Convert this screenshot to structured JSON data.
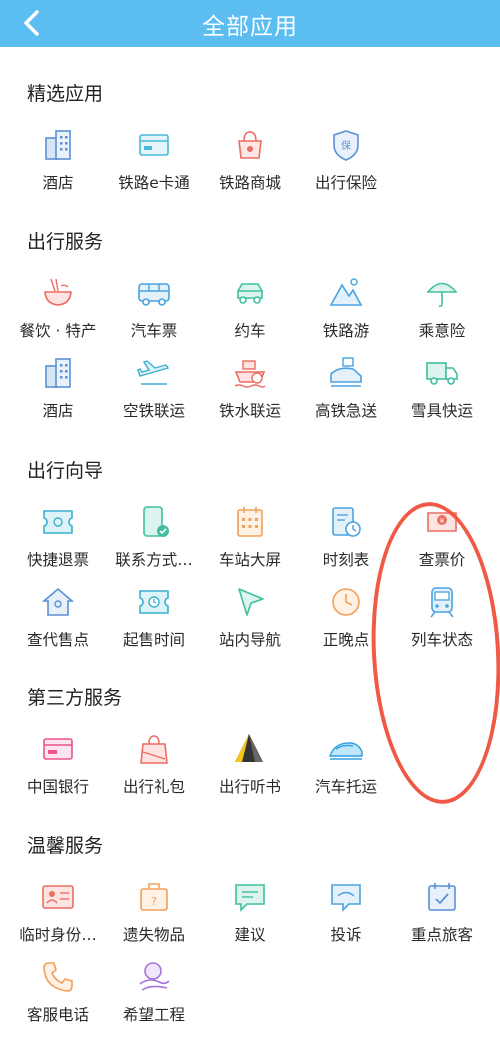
{
  "header": {
    "title": "全部应用",
    "back_icon": "chevron-left-icon",
    "bg_color": "#5bbdf0"
  },
  "sections": {
    "featured": {
      "title": "精选应用",
      "items": [
        {
          "label": "酒店",
          "icon": "hotel-icon"
        },
        {
          "label": "铁路e卡通",
          "icon": "card-icon"
        },
        {
          "label": "铁路商城",
          "icon": "shopping-bag-icon"
        },
        {
          "label": "出行保险",
          "icon": "insurance-shield-icon"
        }
      ]
    },
    "travel": {
      "title": "出行服务",
      "items": [
        {
          "label": "餐饮 · 特产",
          "icon": "noodle-bowl-icon"
        },
        {
          "label": "汽车票",
          "icon": "bus-icon"
        },
        {
          "label": "约车",
          "icon": "car-icon"
        },
        {
          "label": "铁路游",
          "icon": "mountain-icon"
        },
        {
          "label": "乘意险",
          "icon": "umbrella-icon"
        },
        {
          "label": "酒店",
          "icon": "hotel-icon"
        },
        {
          "label": "空铁联运",
          "icon": "plane-icon"
        },
        {
          "label": "铁水联运",
          "icon": "ship-icon"
        },
        {
          "label": "高铁急送",
          "icon": "express-train-icon"
        },
        {
          "label": "雪具快运",
          "icon": "truck-icon"
        }
      ]
    },
    "guide": {
      "title": "出行向导",
      "items": [
        {
          "label": "快捷退票",
          "icon": "refund-ticket-icon"
        },
        {
          "label": "联系方式…",
          "icon": "phone-contact-icon"
        },
        {
          "label": "车站大屏",
          "icon": "station-screen-icon"
        },
        {
          "label": "时刻表",
          "icon": "timetable-icon"
        },
        {
          "label": "查票价",
          "icon": "fare-ticket-icon"
        },
        {
          "label": "查代售点",
          "icon": "agency-house-icon"
        },
        {
          "label": "起售时间",
          "icon": "clock-ticket-icon"
        },
        {
          "label": "站内导航",
          "icon": "navigation-arrow-icon"
        },
        {
          "label": "正晚点",
          "icon": "clock-icon"
        },
        {
          "label": "列车状态",
          "icon": "train-icon"
        }
      ]
    },
    "third_party": {
      "title": "第三方服务",
      "items": [
        {
          "label": "中国银行",
          "icon": "bank-card-icon"
        },
        {
          "label": "出行礼包",
          "icon": "gift-bag-icon"
        },
        {
          "label": "出行听书",
          "icon": "audiobook-icon"
        },
        {
          "label": "汽车托运",
          "icon": "car-shipping-icon"
        }
      ]
    },
    "care": {
      "title": "温馨服务",
      "items": [
        {
          "label": "临时身份…",
          "icon": "id-card-icon"
        },
        {
          "label": "遗失物品",
          "icon": "lost-luggage-icon"
        },
        {
          "label": "建议",
          "icon": "suggestion-icon"
        },
        {
          "label": "投诉",
          "icon": "complaint-icon"
        },
        {
          "label": "重点旅客",
          "icon": "priority-passenger-icon"
        },
        {
          "label": "客服电话",
          "icon": "phone-icon"
        },
        {
          "label": "希望工程",
          "icon": "hope-project-icon"
        }
      ]
    }
  },
  "annotation": {
    "color": "#f05a45"
  }
}
